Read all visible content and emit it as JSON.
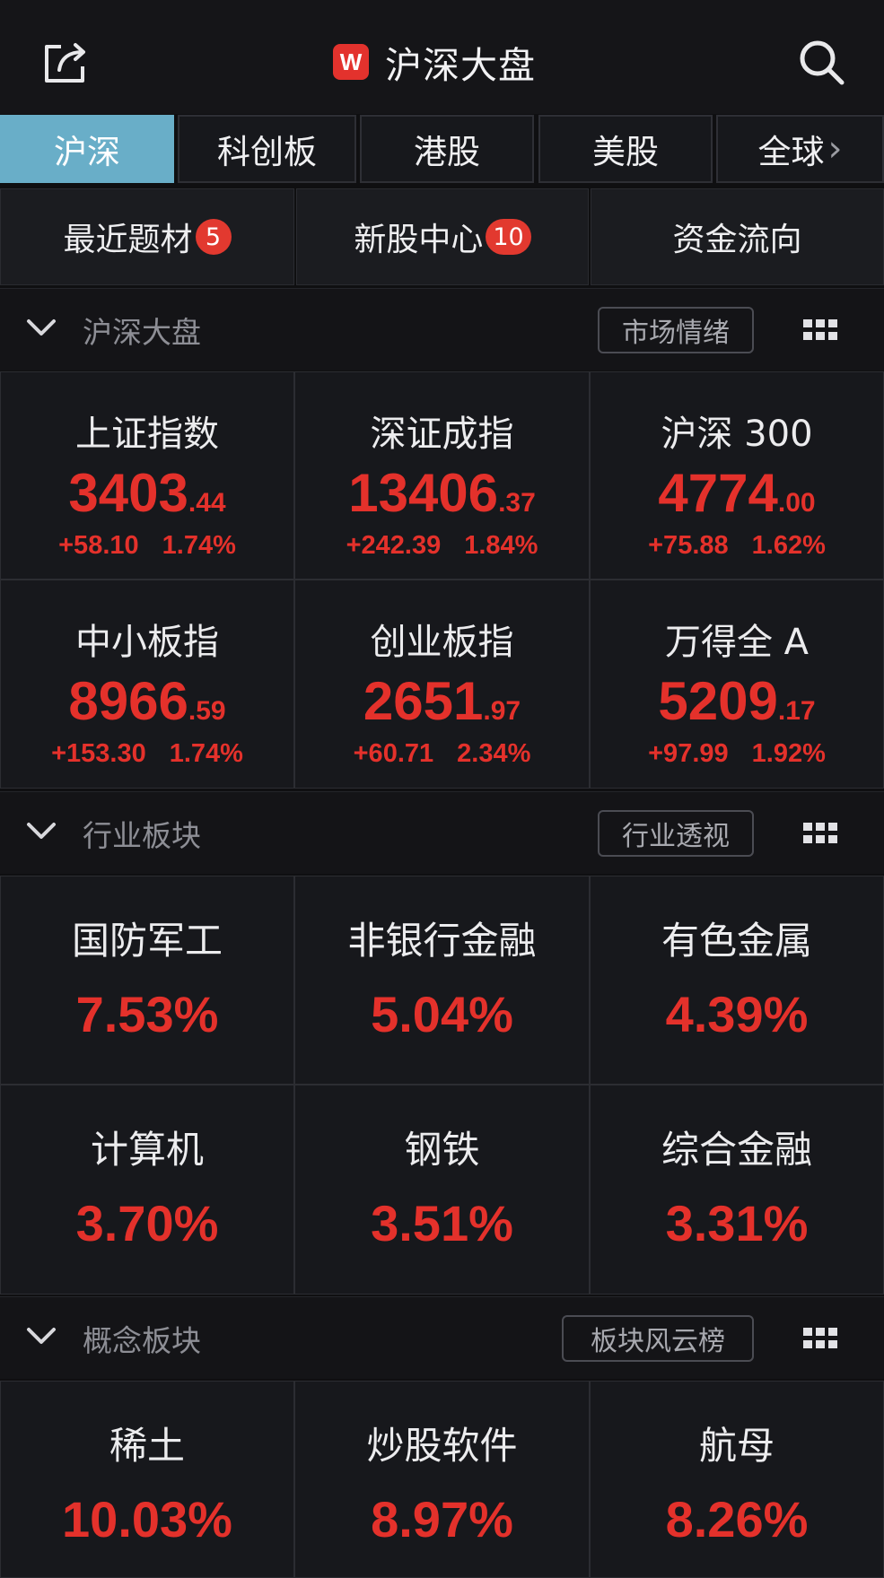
{
  "header": {
    "title": "沪深大盘",
    "logo_letter": "W",
    "icons": [
      "share-icon",
      "search-icon"
    ]
  },
  "tabs": [
    {
      "label": "沪深",
      "active": true
    },
    {
      "label": "科创板",
      "active": false
    },
    {
      "label": "港股",
      "active": false
    },
    {
      "label": "美股",
      "active": false
    },
    {
      "label": "全球",
      "active": false
    }
  ],
  "shortcuts": [
    {
      "label": "最近题材",
      "badge": "5"
    },
    {
      "label": "新股中心",
      "badge": "10"
    },
    {
      "label": "资金流向",
      "badge": ""
    }
  ],
  "sections": {
    "market": {
      "title": "沪深大盘",
      "button": "市场情绪"
    },
    "industry": {
      "title": "行业板块",
      "button": "行业透视"
    },
    "concept": {
      "title": "概念板块",
      "button": "板块风云榜"
    }
  },
  "indices": [
    {
      "name": "上证指数",
      "int": "3403",
      "dec": ".44",
      "change": "+58.10",
      "pct": "1.74%"
    },
    {
      "name": "深证成指",
      "int": "13406",
      "dec": ".37",
      "change": "+242.39",
      "pct": "1.84%"
    },
    {
      "name": "沪深 300",
      "int": "4774",
      "dec": ".00",
      "change": "+75.88",
      "pct": "1.62%"
    },
    {
      "name": "中小板指",
      "int": "8966",
      "dec": ".59",
      "change": "+153.30",
      "pct": "1.74%"
    },
    {
      "name": "创业板指",
      "int": "2651",
      "dec": ".97",
      "change": "+60.71",
      "pct": "2.34%"
    },
    {
      "name": "万得全 A",
      "int": "5209",
      "dec": ".17",
      "change": "+97.99",
      "pct": "1.92%"
    }
  ],
  "industries": [
    {
      "name": "国防军工",
      "pct": "7.53%"
    },
    {
      "name": "非银行金融",
      "pct": "5.04%"
    },
    {
      "name": "有色金属",
      "pct": "4.39%"
    },
    {
      "name": "计算机",
      "pct": "3.70%"
    },
    {
      "name": "钢铁",
      "pct": "3.51%"
    },
    {
      "name": "综合金融",
      "pct": "3.31%"
    }
  ],
  "concepts": [
    {
      "name": "稀土",
      "pct": "10.03%"
    },
    {
      "name": "炒股软件",
      "pct": "8.97%"
    },
    {
      "name": "航母",
      "pct": "8.26%"
    }
  ],
  "colors": {
    "up": "#e4312b",
    "active_tab": "#69aec8",
    "badge": "#e2392f",
    "background": "#0f0f11"
  }
}
